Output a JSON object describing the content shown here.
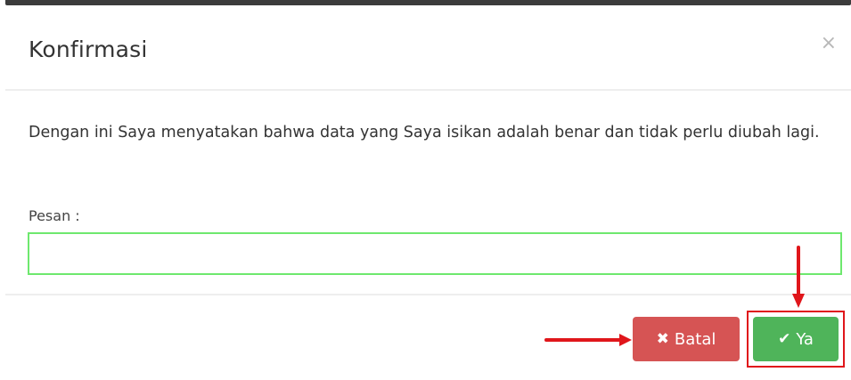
{
  "dialog": {
    "title": "Konfirmasi",
    "close_symbol": "×",
    "message": "Dengan ini Saya menyatakan bahwa data yang Saya isikan adalah benar dan tidak perlu diubah lagi.",
    "field_label": "Pesan :",
    "field_value": "",
    "cancel_icon": "✖",
    "cancel_label": "Batal",
    "ok_icon": "✔",
    "ok_label": "Ya"
  },
  "colors": {
    "cancel_button": "#d65454",
    "ok_button": "#4fb45a",
    "input_border": "#6ee86e",
    "annotation_red": "#e0161b"
  },
  "icons": {
    "close": "close-icon",
    "cancel": "times-icon",
    "ok": "check-icon"
  }
}
